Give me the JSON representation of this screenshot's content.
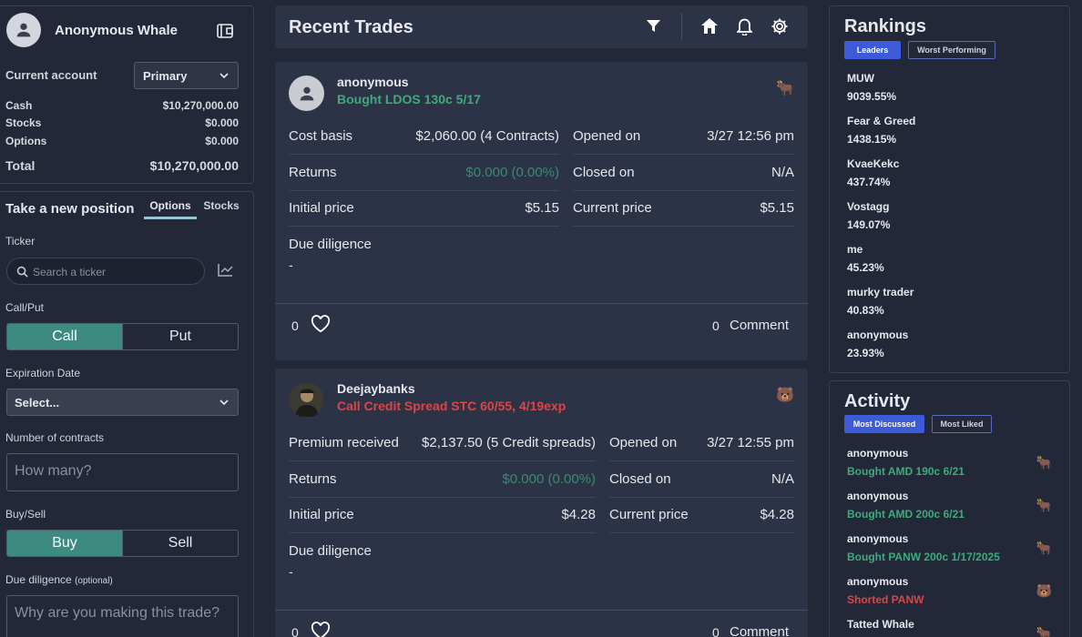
{
  "account": {
    "username": "Anonymous Whale",
    "current_label": "Current account",
    "selected": "Primary",
    "balances": [
      {
        "label": "Cash",
        "value": "$10,270,000.00"
      },
      {
        "label": "Stocks",
        "value": "$0.000"
      },
      {
        "label": "Options",
        "value": "$0.000"
      }
    ],
    "total_label": "Total",
    "total_value": "$10,270,000.00"
  },
  "position": {
    "title": "Take a new position",
    "tabs": [
      "Options",
      "Stocks"
    ],
    "ticker_label": "Ticker",
    "ticker_placeholder": "Search a ticker",
    "callput_label": "Call/Put",
    "call": "Call",
    "put": "Put",
    "expiration_label": "Expiration Date",
    "expiration_value": "Select...",
    "contracts_label": "Number of contracts",
    "contracts_placeholder": "How many?",
    "buysell_label": "Buy/Sell",
    "buy": "Buy",
    "sell": "Sell",
    "dd_label": "Due diligence",
    "dd_optional": "(optional)",
    "dd_placeholder": "Why are you making this trade?"
  },
  "feed": {
    "title": "Recent Trades",
    "trades": [
      {
        "user": "anonymous",
        "action": "Bought LDOS 130c 5/17",
        "emoji": "🐂",
        "rows_left": [
          {
            "label": "Cost basis",
            "value": "$2,060.00 (4 Contracts)"
          },
          {
            "label": "Returns",
            "value": "$0.000 (0.00%)"
          },
          {
            "label": "Initial price",
            "value": "$5.15"
          }
        ],
        "rows_right": [
          {
            "label": "Opened on",
            "value": "3/27 12:56 pm"
          },
          {
            "label": "Closed on",
            "value": "N/A"
          },
          {
            "label": "Current price",
            "value": "$5.15"
          }
        ],
        "dd_label": "Due diligence",
        "dd_value": "-",
        "likes": "0",
        "comments": "0",
        "comment_label": "Comment"
      },
      {
        "user": "Deejaybanks",
        "action": "Call Credit Spread STC 60/55, 4/19exp",
        "emoji": "🐻",
        "rows_left": [
          {
            "label": "Premium received",
            "value": "$2,137.50 (5 Credit spreads)"
          },
          {
            "label": "Returns",
            "value": "$0.000 (0.00%)"
          },
          {
            "label": "Initial price",
            "value": "$4.28"
          }
        ],
        "rows_right": [
          {
            "label": "Opened on",
            "value": "3/27 12:55 pm"
          },
          {
            "label": "Closed on",
            "value": "N/A"
          },
          {
            "label": "Current price",
            "value": "$4.28"
          }
        ],
        "dd_label": "Due diligence",
        "dd_value": "-",
        "likes": "0",
        "comments": "0",
        "comment_label": "Comment"
      }
    ]
  },
  "rankings": {
    "title": "Rankings",
    "tabs": [
      "Leaders",
      "Worst Performing"
    ],
    "items": [
      {
        "name": "MUW",
        "value": "9039.55%"
      },
      {
        "name": "Fear & Greed",
        "value": "1438.15%"
      },
      {
        "name": "KvaeKekc",
        "value": "437.74%"
      },
      {
        "name": "Vostagg",
        "value": "149.07%"
      },
      {
        "name": "me",
        "value": "45.23%"
      },
      {
        "name": "murky trader",
        "value": "40.83%"
      },
      {
        "name": "anonymous",
        "value": "23.93%"
      }
    ]
  },
  "activity": {
    "title": "Activity",
    "tabs": [
      "Most Discussed",
      "Most Liked"
    ],
    "items": [
      {
        "user": "anonymous",
        "action": "Bought AMD 190c 6/21",
        "emoji": "🐂"
      },
      {
        "user": "anonymous",
        "action": "Bought AMD 200c 6/21",
        "emoji": "🐂"
      },
      {
        "user": "anonymous",
        "action": "Bought PANW 200c 1/17/2025",
        "emoji": "🐂"
      },
      {
        "user": "anonymous",
        "action": "Shorted PANW",
        "emoji": "🐻"
      },
      {
        "user": "Tatted Whale",
        "action": "",
        "emoji": "🐂"
      }
    ]
  },
  "colors": {
    "accent_green": "#3dab7d",
    "accent_red": "#d94646",
    "toggle_on": "#3d8b80",
    "tab_on": "#3d5bd9"
  }
}
